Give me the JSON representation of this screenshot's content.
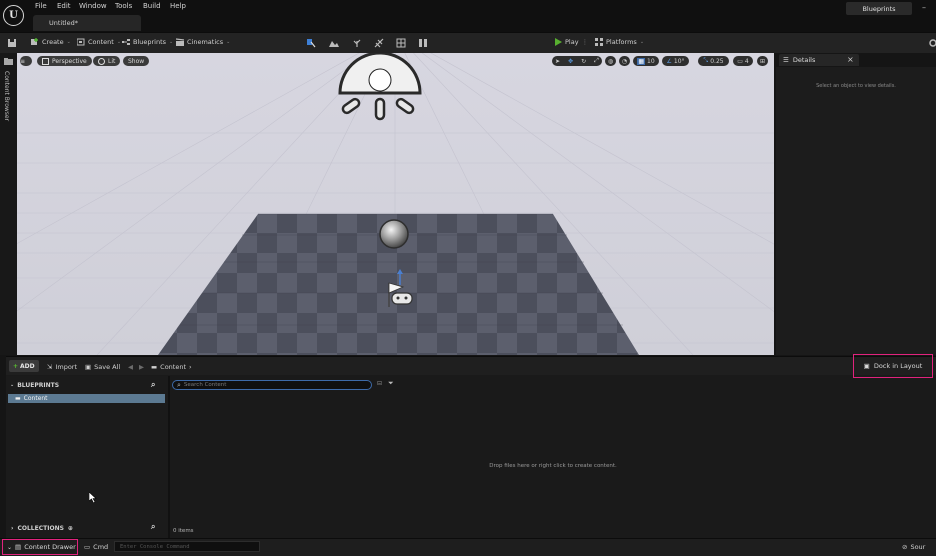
{
  "menu": {
    "items": [
      "File",
      "Edit",
      "Window",
      "Tools",
      "Build",
      "Help"
    ],
    "document_tab": "Untitled*",
    "right_tab": "Blueprints",
    "window_control": "–"
  },
  "toolbar": {
    "create": "Create",
    "content": "Content",
    "blueprints": "Blueprints",
    "cinematics": "Cinematics",
    "play": "Play",
    "platforms": "Platforms"
  },
  "left_strip": {
    "content_browser_label": "Content Browser"
  },
  "viewport": {
    "perspective": "Perspective",
    "lit": "Lit",
    "show": "Show",
    "grid_snap": "10",
    "rotation_snap": "10°",
    "scale_snap": "0.25",
    "camera_speed": "4"
  },
  "details": {
    "tab_label": "Details",
    "close": "×",
    "empty_message": "Select an object to view details."
  },
  "content_drawer": {
    "add": "ADD",
    "import": "Import",
    "save_all": "Save All",
    "path": "Content",
    "dock_in_layout": "Dock in Layout",
    "blueprints_header": "BLUEPRINTS",
    "tree_item": "Content",
    "collections_header": "COLLECTIONS",
    "search_placeholder": "Search Content",
    "drop_message": "Drop files here or right click to create content.",
    "items_count": "0 items"
  },
  "status_bar": {
    "content_drawer": "Content Drawer",
    "cmd": "Cmd",
    "console_placeholder": "Enter Console Command",
    "source_control": "Sour"
  },
  "colors": {
    "highlight_border": "#e0237d",
    "selected_row": "#5c7a92",
    "play_green": "#58b030",
    "search_border": "#3d6aa8"
  }
}
